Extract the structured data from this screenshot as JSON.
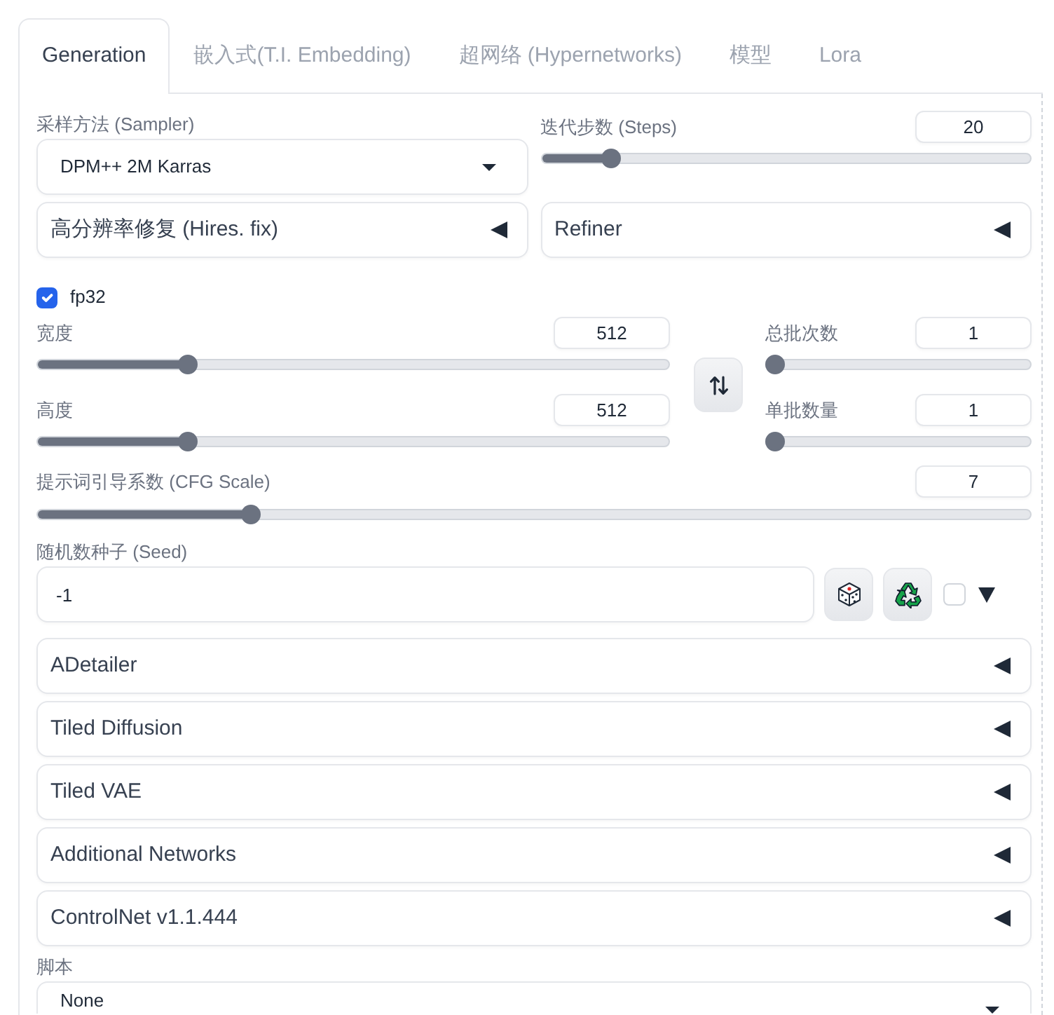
{
  "tabs": [
    {
      "label": "Generation",
      "selected": true
    },
    {
      "label": "嵌入式(T.I. Embedding)",
      "selected": false
    },
    {
      "label": "超网络 (Hypernetworks)",
      "selected": false
    },
    {
      "label": "模型",
      "selected": false
    },
    {
      "label": "Lora",
      "selected": false
    }
  ],
  "sampler": {
    "label": "采样方法 (Sampler)",
    "value": "DPM++ 2M Karras"
  },
  "steps": {
    "label": "迭代步数 (Steps)",
    "value": "20",
    "level": 0.13
  },
  "sections_top": [
    {
      "title": "高分辨率修复 (Hires. fix)",
      "expanded": false
    },
    {
      "title": "Refiner",
      "expanded": false
    }
  ],
  "fp32": {
    "label": "fp32",
    "checked": true
  },
  "size_sliders": [
    {
      "label": "宽度",
      "value": "512",
      "level": 0.23
    },
    {
      "label": "高度",
      "value": "512",
      "level": 0.23
    }
  ],
  "batch_sliders": [
    {
      "label": "总批次数",
      "value": "1",
      "level": 0
    },
    {
      "label": "单批数量",
      "value": "1",
      "level": 0
    }
  ],
  "cfg": {
    "label": "提示词引导系数 (CFG Scale)",
    "value": "7",
    "level": 0.21
  },
  "seed": {
    "label": "随机数种子 (Seed)",
    "value": "-1",
    "extra_checked": false
  },
  "sections": [
    {
      "title": "ADetailer",
      "expanded": false
    },
    {
      "title": "Tiled Diffusion",
      "expanded": false
    },
    {
      "title": "Tiled VAE",
      "expanded": false
    },
    {
      "title": "Additional Networks",
      "expanded": false
    },
    {
      "title": "ControlNet v1.1.444",
      "expanded": false
    }
  ],
  "script": {
    "label": "脚本",
    "value": "None"
  }
}
